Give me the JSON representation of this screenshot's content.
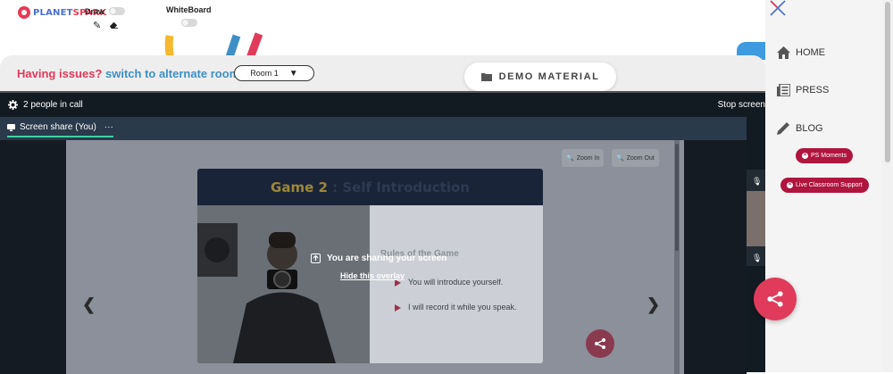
{
  "header": {
    "logo_planet": "PLANET",
    "logo_spark": "SPARK",
    "draw_label": "Draw",
    "whiteboard_label": "WhiteBoard"
  },
  "issues": {
    "prefix": "Having issues?",
    "link": "switch to alternate room",
    "room_selected": "Room 1",
    "demo_label": "DEMO MATERIAL"
  },
  "call": {
    "people_count": "2 people in call",
    "stop_label": "Stop screen",
    "tab_label": "Screen share (You)",
    "tab_more": "···"
  },
  "presentation": {
    "zoom_in": "Zoom In",
    "zoom_out": "Zoom Out",
    "slide_title_game": "Game 2",
    "slide_title_rest": ": Self Introduction",
    "rules_title": "Rules of the Game",
    "rules": [
      "You will introduce yourself.",
      "I will record it while you speak."
    ]
  },
  "overlay": {
    "message": "You are sharing your screen",
    "hide_link": "Hide this overlay"
  },
  "sidebar": {
    "items": [
      {
        "label": "HOME",
        "icon": "home-icon"
      },
      {
        "label": "PRESS",
        "icon": "newspaper-icon"
      },
      {
        "label": "BLOG",
        "icon": "pencil-icon"
      }
    ],
    "ps_moments": "PS Moments",
    "live_support": "Live Classroom Support"
  },
  "colors": {
    "brand_red": "#e13b5c",
    "brand_blue": "#3e8fc5",
    "pill_red": "#b0153e",
    "call_bg": "#121b22"
  }
}
